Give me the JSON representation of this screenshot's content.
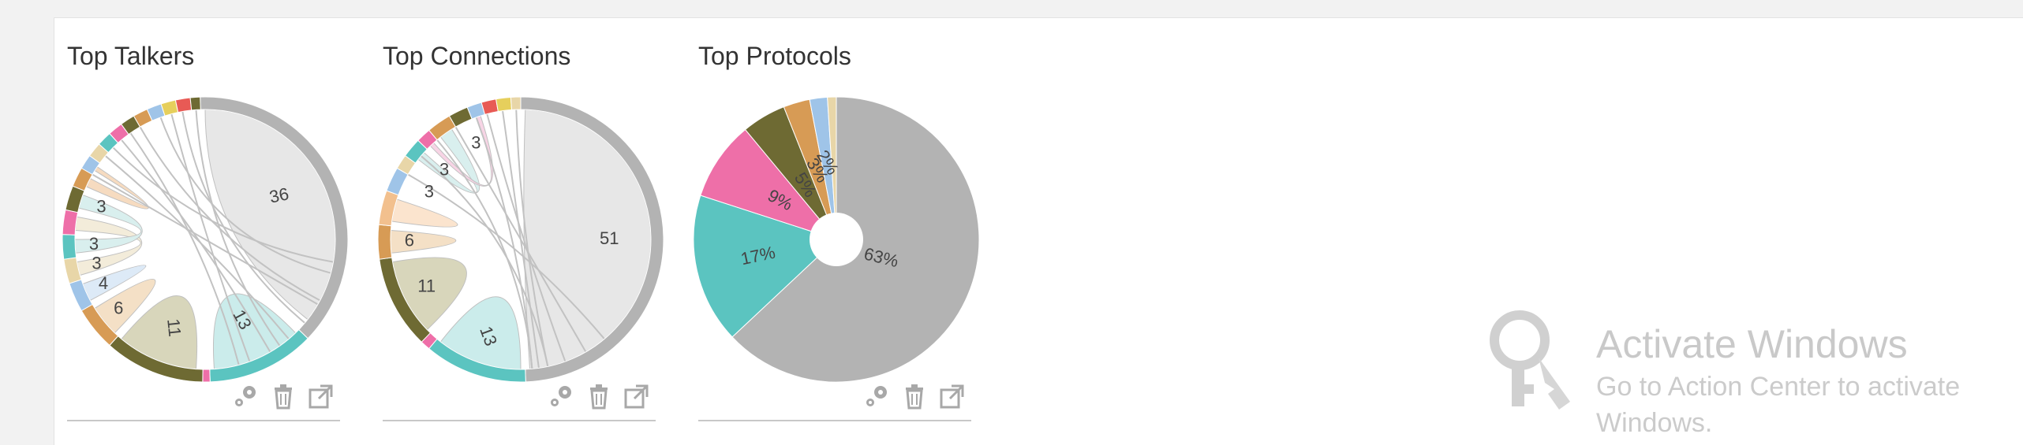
{
  "colors": {
    "gray": "#b3b3b3",
    "teal": "#5bc4c0",
    "pink": "#ee6fa8",
    "olive": "#6e6a33",
    "orange": "#d79b55",
    "lightblue": "#9fc4e8",
    "beige": "#e8d6a8",
    "light_orange": "#f2c08e",
    "yellow": "#e6cf5c",
    "red": "#e85a55"
  },
  "widgets": [
    {
      "title": "Top Talkers",
      "chart_data": {
        "type": "chord",
        "labels": [
          "36",
          "13",
          "11",
          "6",
          "4",
          "3",
          "3",
          "3"
        ],
        "legend": false
      },
      "tools": [
        "settings-icon",
        "trash-icon",
        "external-link-icon"
      ]
    },
    {
      "title": "Top Connections",
      "chart_data": {
        "type": "chord",
        "labels": [
          "51",
          "13",
          "11",
          "6",
          "3",
          "3",
          "3"
        ],
        "legend": false
      },
      "tools": [
        "settings-icon",
        "trash-icon",
        "external-link-icon"
      ]
    },
    {
      "title": "Top Protocols",
      "chart_data": {
        "type": "pie",
        "slices": [
          {
            "label": "63%",
            "value": 63,
            "color": "#b3b3b3"
          },
          {
            "label": "17%",
            "value": 17,
            "color": "#5bc4c0"
          },
          {
            "label": "9%",
            "value": 9,
            "color": "#ee6fa8"
          },
          {
            "label": "5%",
            "value": 5,
            "color": "#6e6a33"
          },
          {
            "label": "3%",
            "value": 3,
            "color": "#d79b55"
          },
          {
            "label": "2%",
            "value": 2,
            "color": "#9fc4e8"
          },
          {
            "label": "",
            "value": 1,
            "color": "#e8d6a8"
          }
        ],
        "legend": false
      },
      "tools": [
        "settings-icon",
        "trash-icon",
        "external-link-icon"
      ]
    }
  ],
  "watermark": {
    "heading": "Activate Windows",
    "line1": "Go to Action Center to activate",
    "line2": "Windows."
  }
}
